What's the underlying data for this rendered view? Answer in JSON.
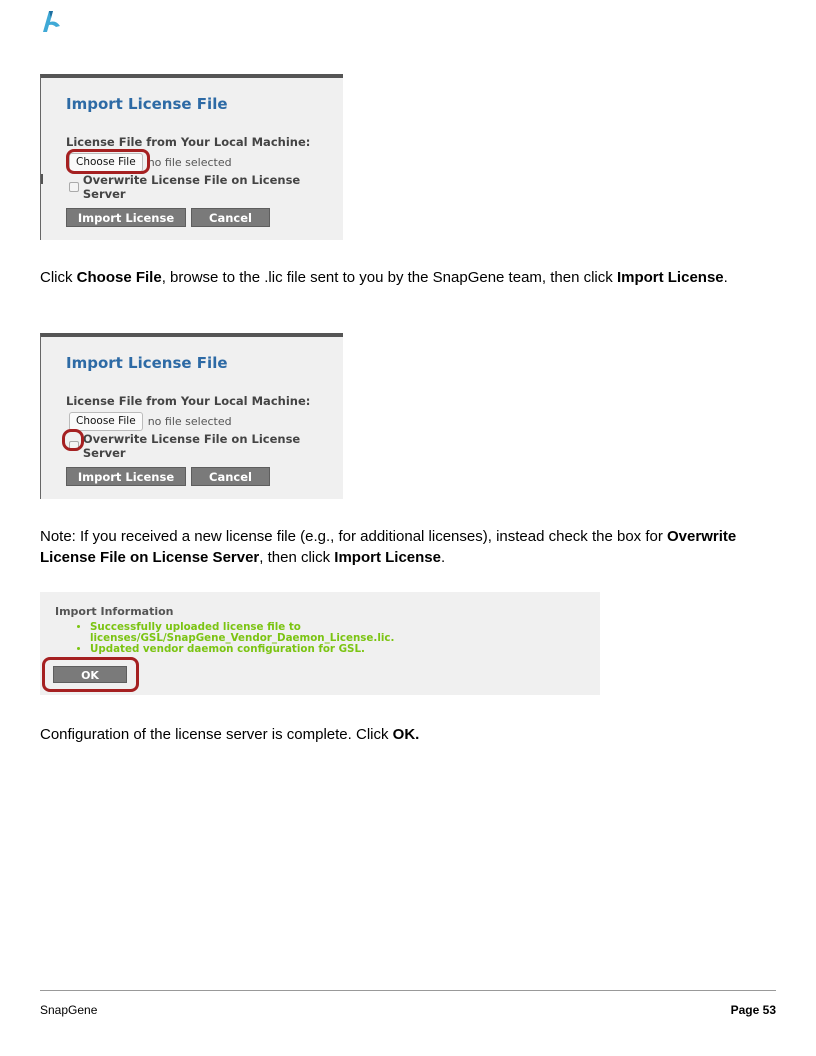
{
  "logo_icon": "snapgene-logo-icon",
  "panel1": {
    "title": "Import License File",
    "file_label": "License File from Your Local Machine:",
    "choose_button": "Choose File",
    "no_file": "no file selected",
    "overwrite_label": "Overwrite License File on License Server",
    "import_button": "Import License",
    "cancel_button": "Cancel"
  },
  "para1": {
    "t1": "Click ",
    "b1": "Choose File",
    "t2": ", browse to the .lic file sent to you by the SnapGene team, then click ",
    "b2": "Import License",
    "t3": "."
  },
  "panel2": {
    "title": "Import License File",
    "file_label": "License File from Your Local Machine:",
    "choose_button": "Choose File",
    "no_file": "no file selected",
    "overwrite_label": "Overwrite License File on License Server",
    "import_button": "Import License",
    "cancel_button": "Cancel"
  },
  "para2": {
    "t1": "Note: If you received a new license file (e.g., for additional licenses), instead check the box for ",
    "b1": "Overwrite License File on License Server",
    "t2": ", then click ",
    "b2": "Import License",
    "t3": "."
  },
  "info": {
    "title": "Import Information",
    "messages": [
      "Successfully uploaded license file to licenses/GSL/SnapGene_Vendor_Daemon_License.lic.",
      "Updated vendor daemon configuration for GSL."
    ],
    "ok_button": "OK"
  },
  "para3": {
    "t1": "Configuration of the license server is complete. Click ",
    "b1": "OK."
  },
  "footer": {
    "left": "SnapGene",
    "right": "Page 53"
  },
  "colors": {
    "highlight": "#a52021",
    "title_blue": "#2d6aa5",
    "success_green": "#7bc412",
    "button_gray": "#7a7a7a"
  }
}
